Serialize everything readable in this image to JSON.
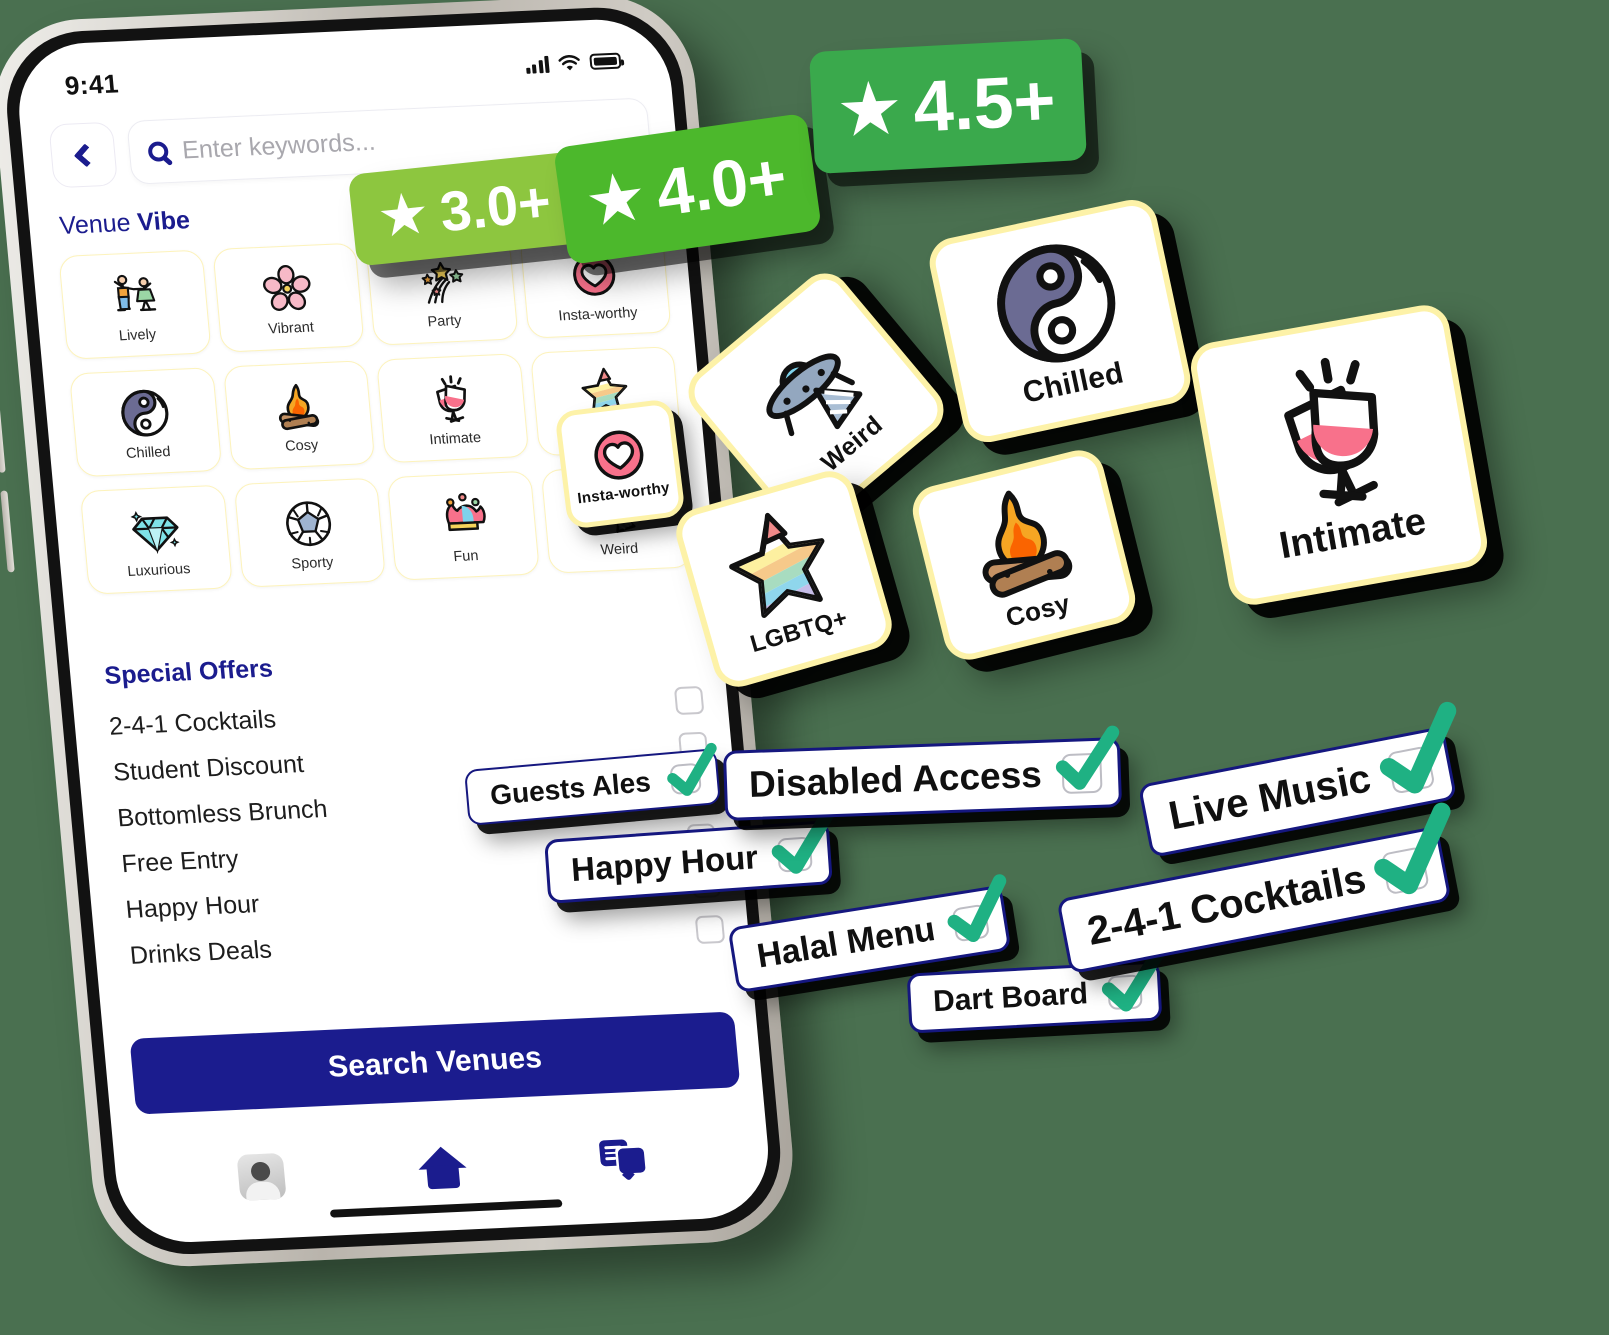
{
  "background_color": "#4a7050",
  "accent_navy": "#1b1c8e",
  "tick_green": "#1fb183",
  "sticker_border": "#fdf2a8",
  "phone": {
    "status": {
      "time": "9:41",
      "signal_icon": "cellular-bars-icon",
      "wifi_icon": "wifi-icon",
      "battery_icon": "battery-full-icon"
    },
    "nav": {
      "back_icon": "chevron-left-icon",
      "back_label": "Back"
    },
    "search": {
      "icon": "search-icon",
      "placeholder": "Enter keywords...",
      "value": ""
    },
    "vibe_section": {
      "title_light": "Venue ",
      "title_bold": "Vibe"
    },
    "vibes": [
      {
        "label": "Lively",
        "icon": "dancing-couple-icon"
      },
      {
        "label": "Vibrant",
        "icon": "cherry-blossom-icon"
      },
      {
        "label": "Party",
        "icon": "sparkle-stars-icon"
      },
      {
        "label": "Insta-worthy",
        "icon": "heart-in-circle-icon"
      },
      {
        "label": "Chilled",
        "icon": "yin-yang-icon"
      },
      {
        "label": "Cosy",
        "icon": "campfire-icon"
      },
      {
        "label": "Intimate",
        "icon": "wine-glasses-cheers-icon"
      },
      {
        "label": "LGBTQ+",
        "icon": "rainbow-star-icon"
      },
      {
        "label": "Luxurious",
        "icon": "diamond-icon"
      },
      {
        "label": "Sporty",
        "icon": "football-icon"
      },
      {
        "label": "Fun",
        "icon": "jester-hat-icon"
      },
      {
        "label": "Weird",
        "icon": "ufo-icon"
      }
    ],
    "offers_section": {
      "title": "Special Offers"
    },
    "offers": [
      {
        "label": "2-4-1 Cocktails",
        "checked": false
      },
      {
        "label": "Student Discount",
        "checked": false
      },
      {
        "label": "Bottomless Brunch",
        "checked": false
      },
      {
        "label": "Free Entry",
        "checked": false
      },
      {
        "label": "Happy Hour",
        "checked": false
      },
      {
        "label": "Drinks Deals",
        "checked": false
      }
    ],
    "cta": {
      "label": "Search Venues"
    },
    "tabbar": [
      {
        "name": "profile",
        "icon": "avatar-icon"
      },
      {
        "name": "home",
        "icon": "home-icon"
      },
      {
        "name": "chat",
        "icon": "chat-messages-icon"
      }
    ]
  },
  "ratings": [
    {
      "id": "r30",
      "star": "★",
      "label": "3.0+",
      "color": "#8dc63f"
    },
    {
      "id": "r40",
      "star": "★",
      "label": "4.0+",
      "color": "#4cb82c"
    },
    {
      "id": "r45",
      "star": "★",
      "label": "4.5+",
      "color": "#3aa94c"
    }
  ],
  "stickers": [
    {
      "id": "insta",
      "label": "Insta-worthy",
      "icon": "heart-in-circle-icon"
    },
    {
      "id": "weird",
      "label": "Weird",
      "icon": "ufo-icon"
    },
    {
      "id": "chilled",
      "label": "Chilled",
      "icon": "yin-yang-icon"
    },
    {
      "id": "lgbtq",
      "label": "LGBTQ+",
      "icon": "rainbow-star-icon"
    },
    {
      "id": "cosy",
      "label": "Cosy",
      "icon": "campfire-icon"
    },
    {
      "id": "intimate",
      "label": "Intimate",
      "icon": "wine-glasses-cheers-icon"
    }
  ],
  "pills": [
    {
      "id": "guests",
      "label": "Guests Ales",
      "checked": true
    },
    {
      "id": "happy",
      "label": "Happy Hour",
      "checked": true
    },
    {
      "id": "disabled",
      "label": "Disabled Access",
      "checked": true
    },
    {
      "id": "halal",
      "label": "Halal Menu",
      "checked": true
    },
    {
      "id": "dart",
      "label": "Dart Board",
      "checked": true
    },
    {
      "id": "live",
      "label": "Live Music",
      "checked": true
    },
    {
      "id": "c241",
      "label": "2-4-1 Cocktails",
      "checked": true
    }
  ]
}
